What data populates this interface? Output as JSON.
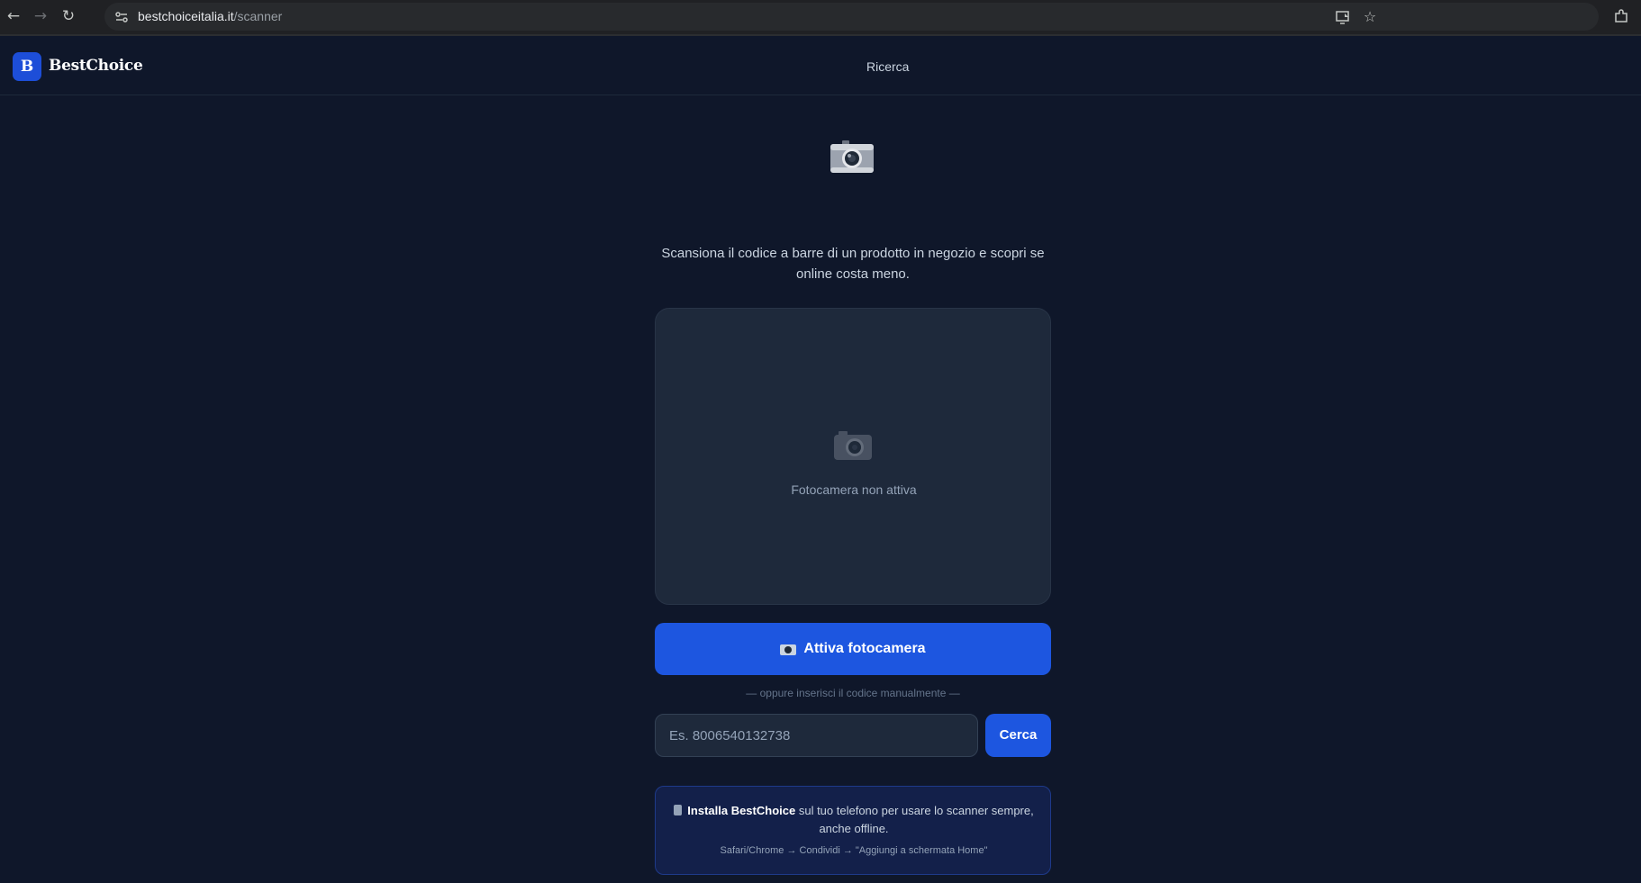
{
  "browser": {
    "url_domain": "bestchoiceitalia.it",
    "url_path": "/scanner",
    "back_icon": "arrow-left-icon",
    "forward_icon": "arrow-right-icon",
    "reload_icon": "reload-icon"
  },
  "header": {
    "logo_letter": "B",
    "brand": "BestChoice",
    "nav_link": "Ricerca"
  },
  "scanner": {
    "hero_icon": "camera-icon",
    "subtitle": "Scansiona il codice a barre di un prodotto in negozio e scopri se online costa meno.",
    "camera_status": "Fotocamera non attiva",
    "activate_label": "Attiva fotocamera",
    "divider": "— oppure inserisci il codice manualmente —",
    "input_placeholder": "Es. 8006540132738",
    "search_label": "Cerca"
  },
  "install": {
    "title": "Installa BestChoice",
    "text": "sul tuo telefono per usare lo scanner sempre, anche offline.",
    "hint": "Safari/Chrome → Condividi → \"Aggiungi a schermata Home\""
  },
  "colors": {
    "background": "#0f172a",
    "card": "#1e293b",
    "accent": "#1d56e0"
  }
}
